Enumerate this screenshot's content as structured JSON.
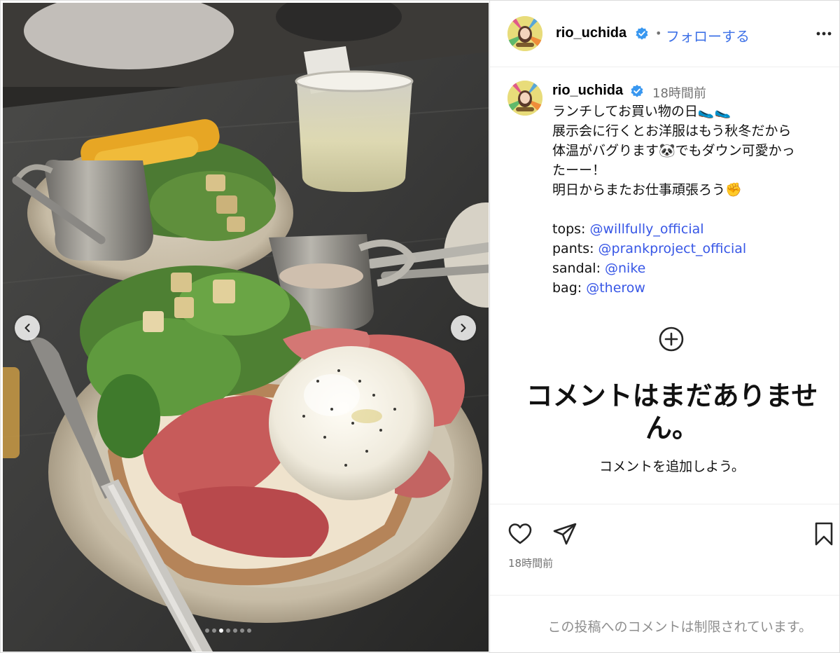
{
  "account": {
    "username": "rio_uchida",
    "follow_label": "フォローする",
    "separator": "•"
  },
  "caption": {
    "username": "rio_uchida",
    "time": "18時間前",
    "lines": [
      "ランチしてお買い物の日🥿🥿",
      "展示会に行くとお洋服はもう秋冬だから",
      "体温がバグります🐼でもダウン可愛かっ",
      "たーー！",
      "明日からまたお仕事頑張ろう✊"
    ],
    "credits": [
      {
        "label": "tops:",
        "mention": "@willfully_official"
      },
      {
        "label": "pants:",
        "mention": "@prankproject_official"
      },
      {
        "label": "sandal:",
        "mention": "@nike"
      },
      {
        "label": "bag:",
        "mention": "@therow"
      }
    ]
  },
  "comments": {
    "empty_title": "コメントはまだありません。",
    "empty_sub": "コメントを追加しよう。"
  },
  "actions": {
    "post_time": "18時間前"
  },
  "footer": {
    "restricted_text": "この投稿へのコメントは制限されています。"
  },
  "carousel": {
    "dot_count": 7,
    "active_index": 2
  },
  "icons": {
    "verified": "verified-badge-icon",
    "more": "more-options-icon",
    "add": "add-comment-icon",
    "like": "heart-icon",
    "share": "send-icon",
    "save": "bookmark-icon",
    "prev": "chevron-left-icon",
    "next": "chevron-right-icon"
  },
  "colors": {
    "accent": "#3f72e7",
    "mention": "#3857e6",
    "verified": "#3897f0",
    "muted": "#737373"
  }
}
